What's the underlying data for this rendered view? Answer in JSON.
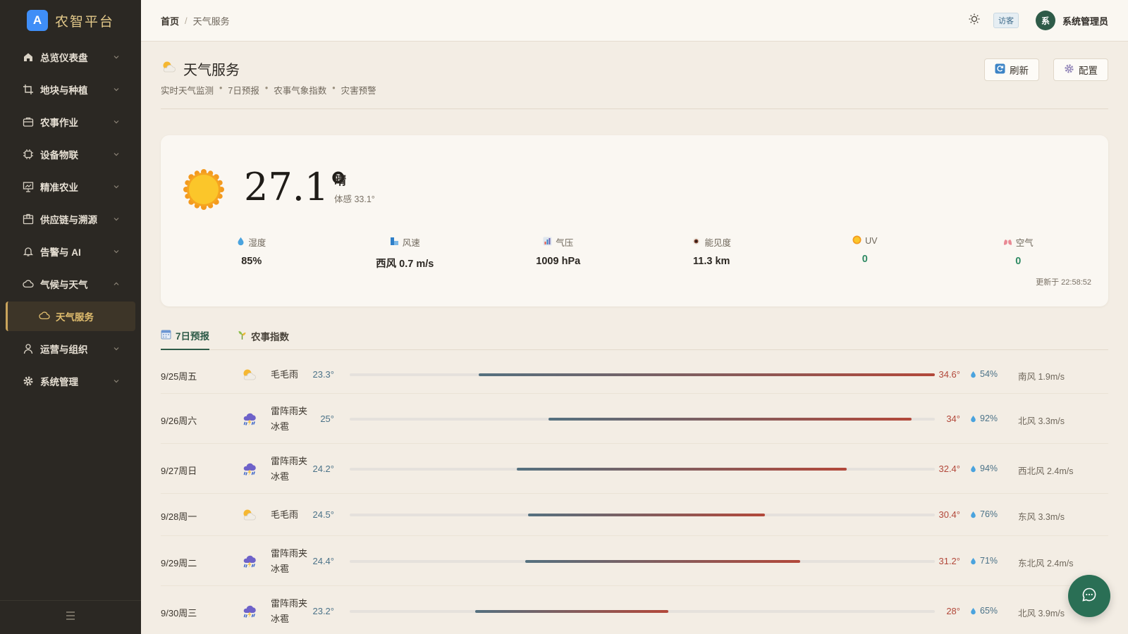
{
  "brand": {
    "logo_letter": "A",
    "name": "农智平台"
  },
  "sidebar": {
    "items": [
      {
        "label": "总览仪表盘",
        "icon": "home-icon"
      },
      {
        "label": "地块与种植",
        "icon": "crop-icon"
      },
      {
        "label": "农事作业",
        "icon": "briefcase-icon"
      },
      {
        "label": "设备物联",
        "icon": "chip-icon"
      },
      {
        "label": "精准农业",
        "icon": "chart-board-icon"
      },
      {
        "label": "供应链与溯源",
        "icon": "package-icon"
      },
      {
        "label": "告警与 AI",
        "icon": "bell-icon"
      },
      {
        "label": "气候与天气",
        "icon": "cloud-icon",
        "expanded": true
      },
      {
        "label": "运营与组织",
        "icon": "user-icon"
      },
      {
        "label": "系统管理",
        "icon": "gear-icon"
      }
    ],
    "sub_active": {
      "label": "天气服务",
      "icon": "cloud-icon"
    }
  },
  "topbar": {
    "breadcrumb_home": "首页",
    "breadcrumb_sep": "/",
    "breadcrumb_current": "天气服务",
    "guest_badge": "访客",
    "avatar_letter": "系",
    "user_name": "系统管理员"
  },
  "page": {
    "title": "天气服务",
    "subtitle_parts": [
      "实时天气监测",
      "7日预报",
      "农事气象指数",
      "灾害预警"
    ],
    "refresh_label": "刷新",
    "config_label": "配置"
  },
  "current": {
    "temp": "27.1°",
    "condition": "晴",
    "feels_like": "体感 33.1°",
    "metrics": [
      {
        "label": "湿度",
        "value": "85%",
        "icon": "droplet-icon"
      },
      {
        "label": "风速",
        "value": "西风 0.7 m/s",
        "icon": "wind-icon"
      },
      {
        "label": "气压",
        "value": "1009 hPa",
        "icon": "barometer-icon"
      },
      {
        "label": "能见度",
        "value": "11.3 km",
        "icon": "eye-icon"
      },
      {
        "label": "UV",
        "value": "0",
        "icon": "uv-icon"
      },
      {
        "label": "空气",
        "value": "0",
        "icon": "lungs-icon"
      }
    ],
    "updated": "更新于 22:58:52"
  },
  "tabs": [
    {
      "label": "7日预报",
      "icon": "calendar-icon",
      "active": true
    },
    {
      "label": "农事指数",
      "icon": "sprout-icon",
      "active": false
    }
  ],
  "forecast": [
    {
      "date": "9/25周五",
      "cond": "毛毛雨",
      "icon": "sun-cloud-icon",
      "low": "23.3°",
      "high": "34.6°",
      "humidity": "54%",
      "wind": "南风 1.9m/s",
      "range": [
        0.22,
        1.0
      ]
    },
    {
      "date": "9/26周六",
      "cond": "雷阵雨夹冰雹",
      "icon": "thunderstorm-icon",
      "low": "25°",
      "high": "34°",
      "humidity": "92%",
      "wind": "北风 3.3m/s",
      "range": [
        0.34,
        0.96
      ]
    },
    {
      "date": "9/27周日",
      "cond": "雷阵雨夹冰雹",
      "icon": "thunderstorm-icon",
      "low": "24.2°",
      "high": "32.4°",
      "humidity": "94%",
      "wind": "西北风 2.4m/s",
      "range": [
        0.285,
        0.85
      ]
    },
    {
      "date": "9/28周一",
      "cond": "毛毛雨",
      "icon": "sun-cloud-icon",
      "low": "24.5°",
      "high": "30.4°",
      "humidity": "76%",
      "wind": "东风 3.3m/s",
      "range": [
        0.305,
        0.71
      ]
    },
    {
      "date": "9/29周二",
      "cond": "雷阵雨夹冰雹",
      "icon": "thunderstorm-icon",
      "low": "24.4°",
      "high": "31.2°",
      "humidity": "71%",
      "wind": "东北风 2.4m/s",
      "range": [
        0.3,
        0.77
      ]
    },
    {
      "date": "9/30周三",
      "cond": "雷阵雨夹冰雹",
      "icon": "thunderstorm-icon",
      "low": "23.2°",
      "high": "28°",
      "humidity": "65%",
      "wind": "北风 3.9m/s",
      "range": [
        0.215,
        0.545
      ]
    }
  ],
  "colors": {
    "sidebar_bg": "#2b2823",
    "accent": "#2e5b48",
    "high_temp": "#b2483a",
    "low_temp": "#4b7288",
    "active_gold": "#e0bd6e"
  }
}
